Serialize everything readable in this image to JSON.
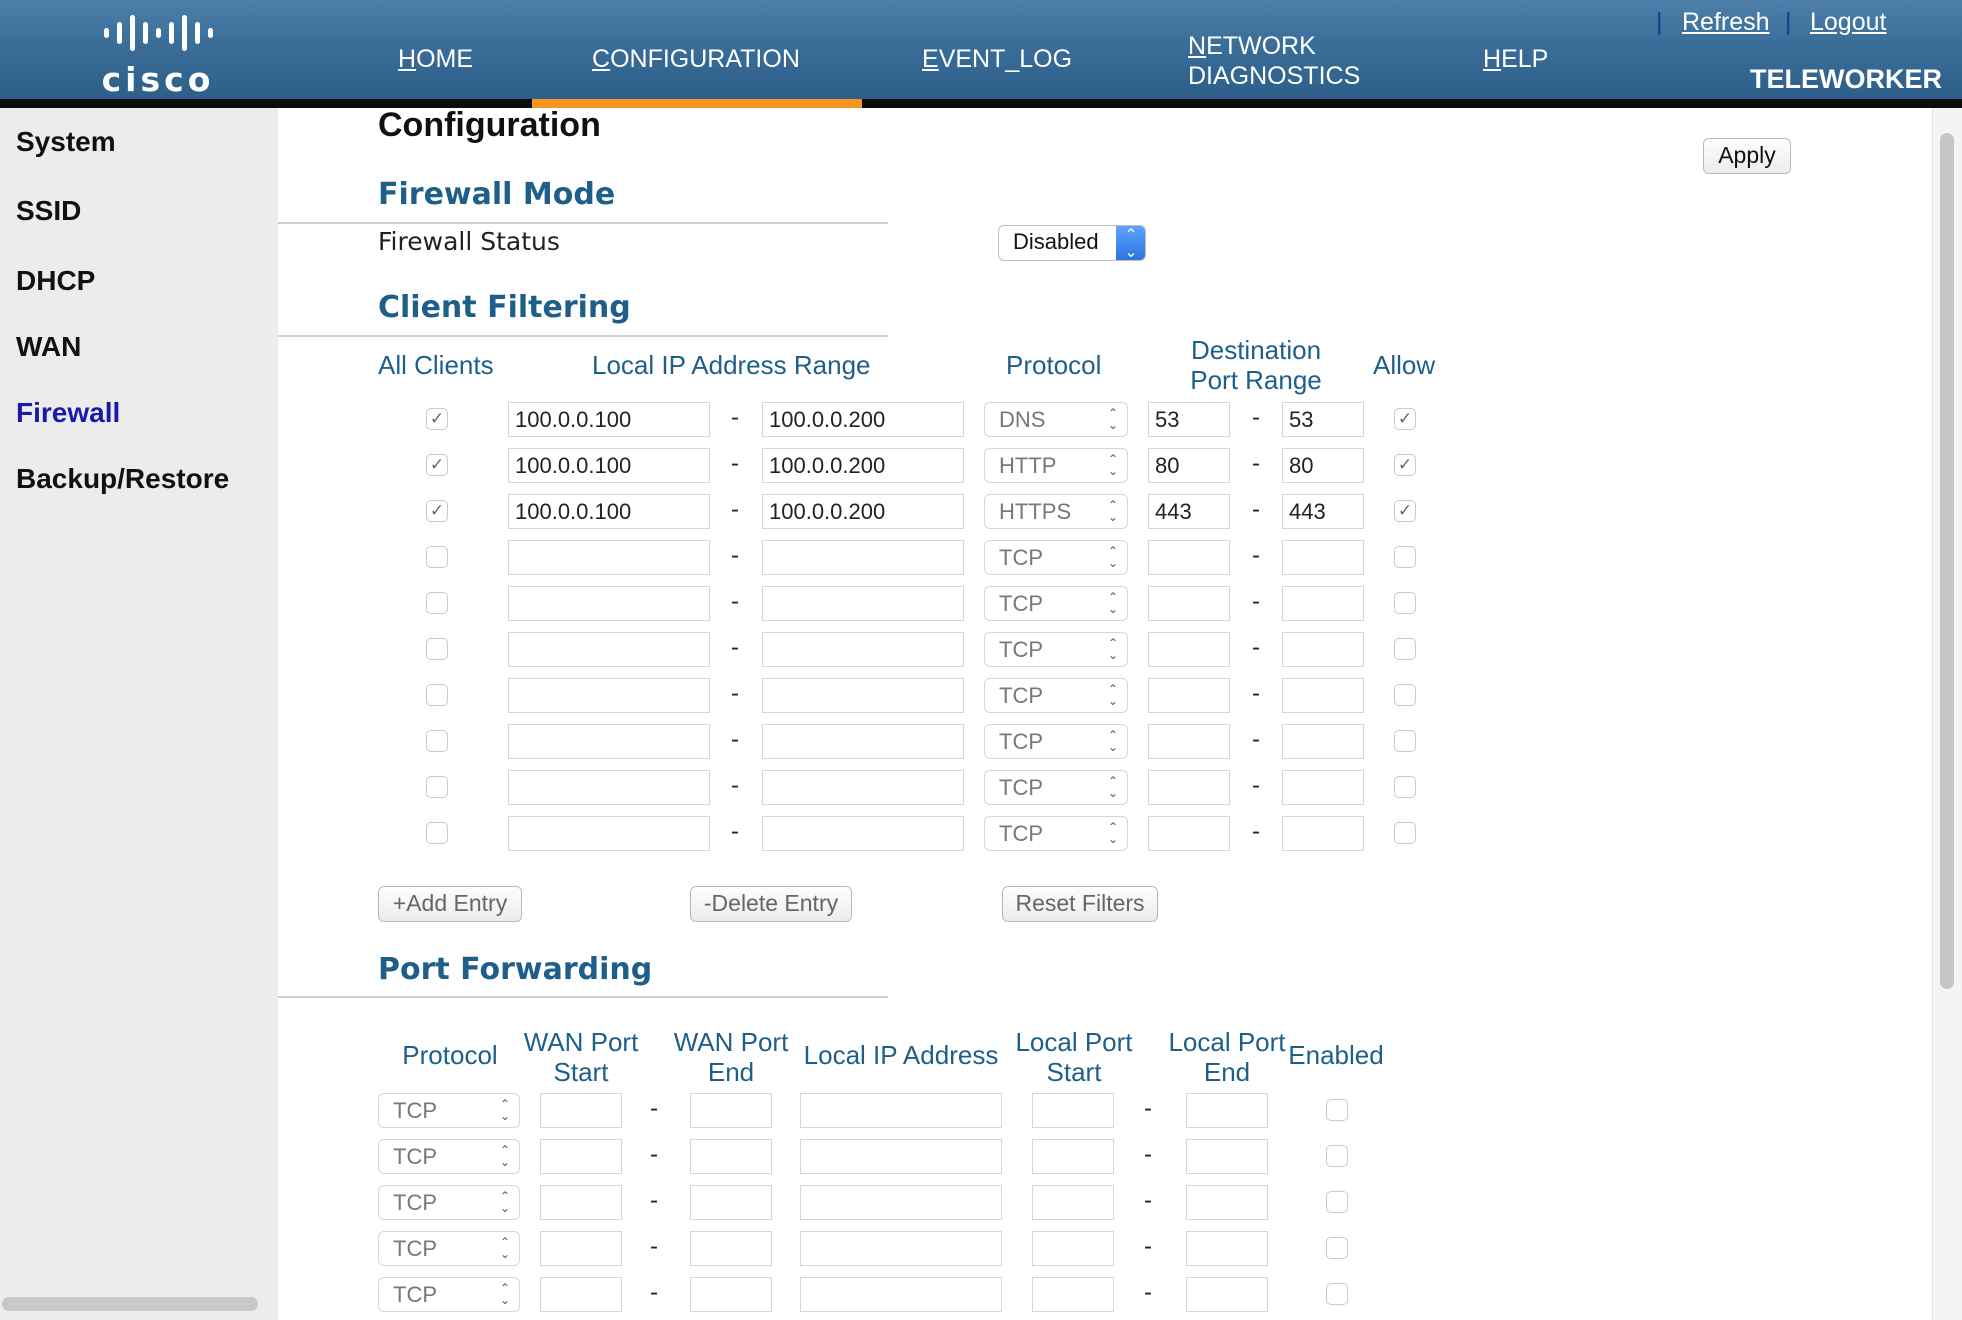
{
  "header": {
    "logo_text": "cisco",
    "nav": [
      {
        "key": "H",
        "rest": "OME"
      },
      {
        "key": "C",
        "rest": "ONFIGURATION"
      },
      {
        "key": "E",
        "rest": "VENT_LOG"
      },
      {
        "key": "N",
        "rest": "ETWORK",
        "line2": "DIAGNOSTICS"
      },
      {
        "key": "H",
        "rest": "ELP"
      }
    ],
    "pipe": "|",
    "refresh": "Refresh",
    "logout": "Logout",
    "mode": "TELEWORKER"
  },
  "sidebar": {
    "items": [
      "System",
      "SSID",
      "DHCP",
      "WAN",
      "Firewall",
      "Backup/Restore"
    ]
  },
  "page": {
    "title": "Configuration",
    "apply": "Apply"
  },
  "firewall_mode": {
    "title": "Firewall Mode",
    "status_label": "Firewall Status",
    "status_value": "Disabled"
  },
  "client_filtering": {
    "title": "Client Filtering",
    "headers": {
      "all_clients": "All Clients",
      "ip_range": "Local IP Address Range",
      "protocol": "Protocol",
      "dest_line1": "Destination",
      "dest_line2": "Port Range",
      "allow": "Allow"
    },
    "dash": "-",
    "rows": [
      {
        "checked": true,
        "ip_start": "100.0.0.100",
        "ip_end": "100.0.0.200",
        "protocol": "DNS",
        "port_start": "53",
        "port_end": "53",
        "allow": true
      },
      {
        "checked": true,
        "ip_start": "100.0.0.100",
        "ip_end": "100.0.0.200",
        "protocol": "HTTP",
        "port_start": "80",
        "port_end": "80",
        "allow": true
      },
      {
        "checked": true,
        "ip_start": "100.0.0.100",
        "ip_end": "100.0.0.200",
        "protocol": "HTTPS",
        "port_start": "443",
        "port_end": "443",
        "allow": true
      },
      {
        "checked": false,
        "ip_start": "",
        "ip_end": "",
        "protocol": "TCP",
        "port_start": "",
        "port_end": "",
        "allow": false
      },
      {
        "checked": false,
        "ip_start": "",
        "ip_end": "",
        "protocol": "TCP",
        "port_start": "",
        "port_end": "",
        "allow": false
      },
      {
        "checked": false,
        "ip_start": "",
        "ip_end": "",
        "protocol": "TCP",
        "port_start": "",
        "port_end": "",
        "allow": false
      },
      {
        "checked": false,
        "ip_start": "",
        "ip_end": "",
        "protocol": "TCP",
        "port_start": "",
        "port_end": "",
        "allow": false
      },
      {
        "checked": false,
        "ip_start": "",
        "ip_end": "",
        "protocol": "TCP",
        "port_start": "",
        "port_end": "",
        "allow": false
      },
      {
        "checked": false,
        "ip_start": "",
        "ip_end": "",
        "protocol": "TCP",
        "port_start": "",
        "port_end": "",
        "allow": false
      },
      {
        "checked": false,
        "ip_start": "",
        "ip_end": "",
        "protocol": "TCP",
        "port_start": "",
        "port_end": "",
        "allow": false
      }
    ],
    "buttons": {
      "add": "+Add Entry",
      "delete": "-Delete Entry",
      "reset": "Reset Filters"
    }
  },
  "port_forwarding": {
    "title": "Port Forwarding",
    "headers": {
      "protocol": "Protocol",
      "wan_start_1": "WAN Port",
      "wan_start_2": "Start",
      "wan_end_1": "WAN Port",
      "wan_end_2": "End",
      "local_ip": "Local IP Address",
      "local_start_1": "Local Port",
      "local_start_2": "Start",
      "local_end_1": "Local Port",
      "local_end_2": "End",
      "enabled": "Enabled"
    },
    "dash": "-",
    "rows": [
      {
        "protocol": "TCP",
        "wan_start": "",
        "wan_end": "",
        "local_ip": "",
        "local_start": "",
        "local_end": "",
        "enabled": false
      },
      {
        "protocol": "TCP",
        "wan_start": "",
        "wan_end": "",
        "local_ip": "",
        "local_start": "",
        "local_end": "",
        "enabled": false
      },
      {
        "protocol": "TCP",
        "wan_start": "",
        "wan_end": "",
        "local_ip": "",
        "local_start": "",
        "local_end": "",
        "enabled": false
      },
      {
        "protocol": "TCP",
        "wan_start": "",
        "wan_end": "",
        "local_ip": "",
        "local_start": "",
        "local_end": "",
        "enabled": false
      },
      {
        "protocol": "TCP",
        "wan_start": "",
        "wan_end": "",
        "local_ip": "",
        "local_start": "",
        "local_end": "",
        "enabled": false
      }
    ]
  },
  "colors": {
    "header_blue": "#3a6d98",
    "accent_orange": "#f7941d",
    "section_blue": "#1e5f8a",
    "active_link": "#1a1aa8",
    "select_blue": "#2b74e0"
  },
  "icons": {
    "select_arrows": "updown-chevron-icon",
    "check": "checkmark-icon"
  }
}
